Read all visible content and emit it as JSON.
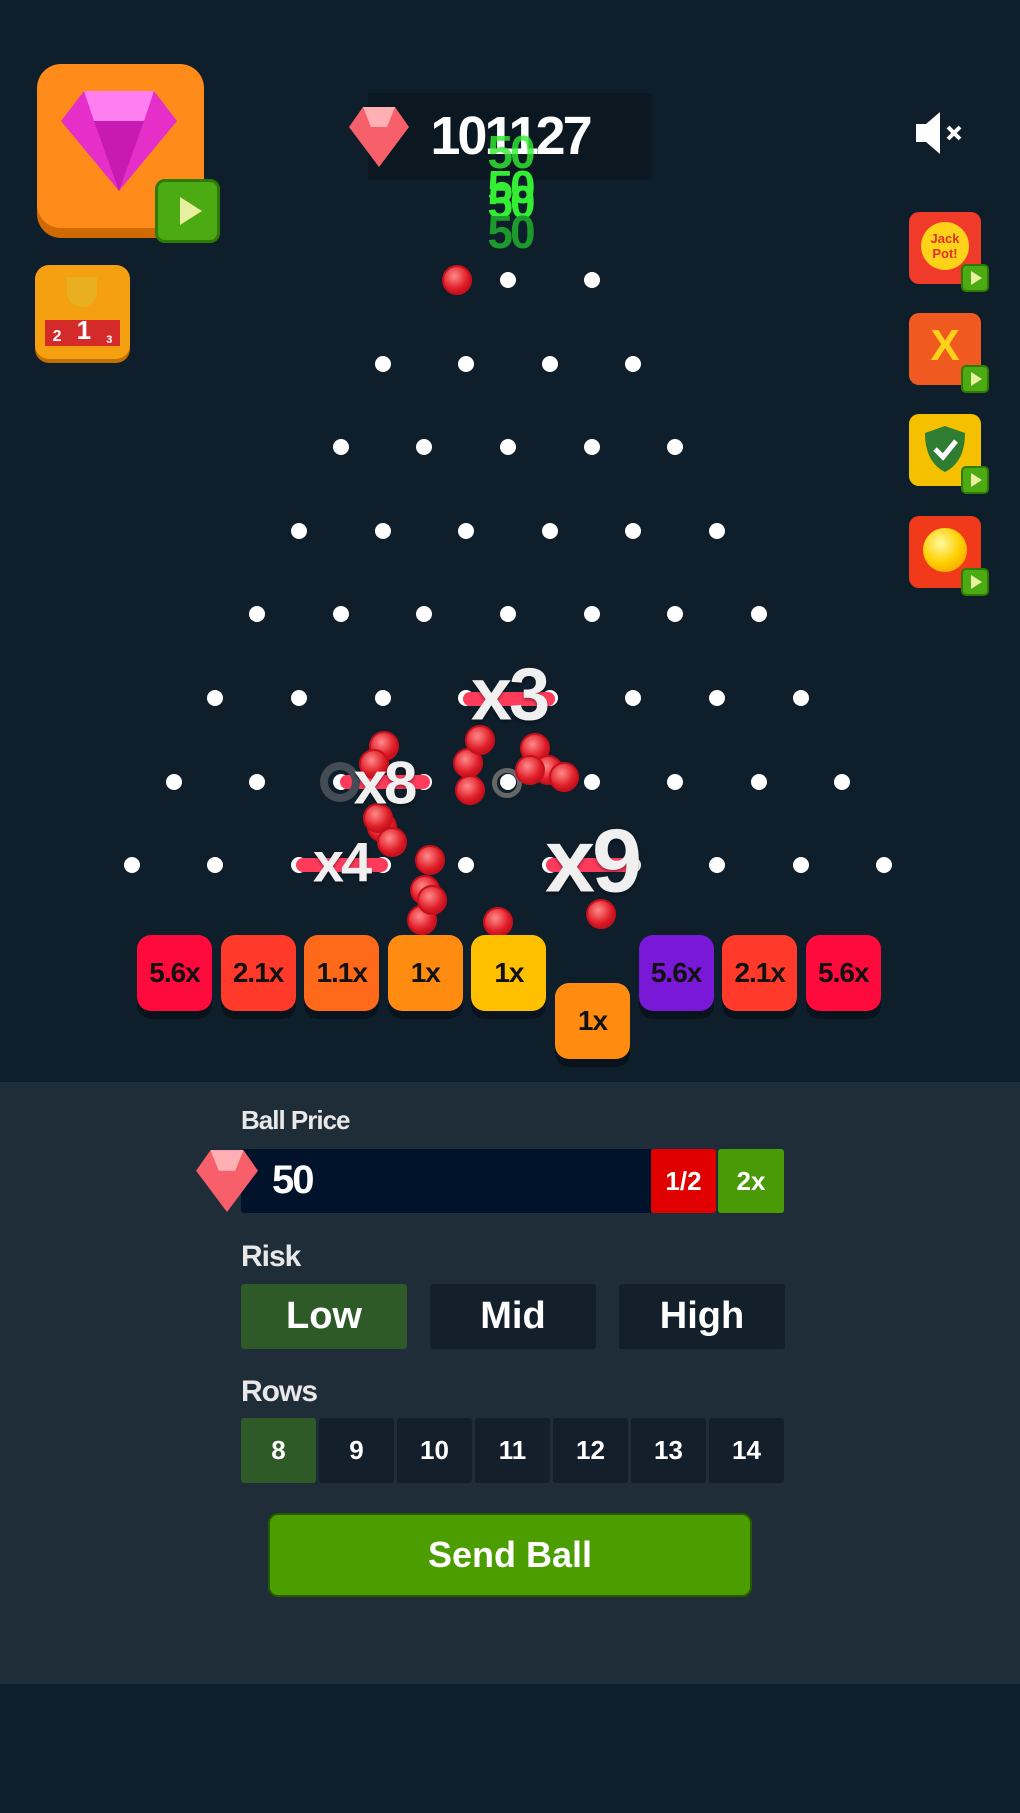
{
  "header": {
    "score": "101127",
    "gem_icon": "red-gem-icon",
    "sound_icon": "mute-icon"
  },
  "left_buttons": [
    {
      "name": "free-gems",
      "icon": "pink-diamond-icon"
    },
    {
      "name": "leaderboard",
      "icon": "trophy-podium-icon",
      "podium": [
        "2",
        "1",
        "3"
      ]
    }
  ],
  "right_buttons": [
    {
      "name": "jackpot",
      "text": "Jack Pot!",
      "color": "#f03a2a"
    },
    {
      "name": "multiplier",
      "text": "X",
      "color": "#f05a20"
    },
    {
      "name": "shield",
      "icon": "shield-check-icon",
      "color": "#f5c000"
    },
    {
      "name": "golden-ball",
      "icon": "golden-ball-icon",
      "color": "#f03a1a"
    }
  ],
  "floating_wins": [
    "50",
    "50",
    "50",
    "50"
  ],
  "board": {
    "rows": 8
  },
  "multiplier_popups": [
    {
      "label": "x3"
    },
    {
      "label": "x8"
    },
    {
      "label": "x4"
    },
    {
      "label": "x9"
    }
  ],
  "bins": [
    {
      "label": "5.6x",
      "color": "#ff0a3c"
    },
    {
      "label": "2.1x",
      "color": "#ff3a2a"
    },
    {
      "label": "1.1x",
      "color": "#ff6a1a"
    },
    {
      "label": "1x",
      "color": "#ff8c10"
    },
    {
      "label": "1x",
      "color": "#ffc000"
    },
    {
      "label": "1x",
      "color": "#ff8c10",
      "active": true
    },
    {
      "label": "5.6x",
      "color": "#7a18d8"
    },
    {
      "label": "2.1x",
      "color": "#ff3a2a"
    },
    {
      "label": "5.6x",
      "color": "#ff0a3c"
    }
  ],
  "controls": {
    "ball_price_label": "Ball Price",
    "ball_price": "50",
    "half_label": "1/2",
    "double_label": "2x",
    "risk_label": "Risk",
    "risk_options": [
      "Low",
      "Mid",
      "High"
    ],
    "risk_selected": "Low",
    "rows_label": "Rows",
    "rows_options": [
      "8",
      "9",
      "10",
      "11",
      "12",
      "13",
      "14"
    ],
    "rows_selected": "8",
    "send_label": "Send Ball"
  },
  "colors": {
    "background": "#0f1e2b",
    "panel": "#1f2d38",
    "selected": "#2d5a27",
    "send": "#4c9e00",
    "half": "#e00000",
    "double": "#4a9a08"
  }
}
